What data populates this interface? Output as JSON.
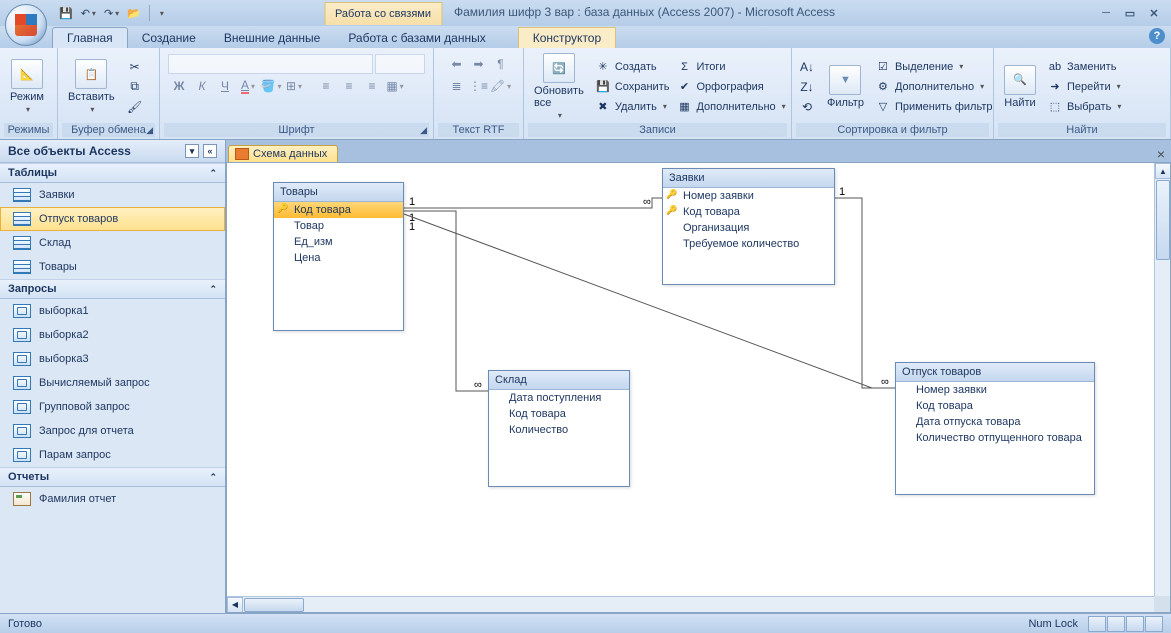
{
  "title": "Фамилия шифр 3 вар : база данных (Access 2007) - Microsoft Access",
  "contextual_title": "Работа со связями",
  "tabs": {
    "home": "Главная",
    "create": "Создание",
    "external": "Внешние данные",
    "dbtools": "Работа с базами данных",
    "designer": "Конструктор"
  },
  "ribbon": {
    "modes": {
      "view": "Режим",
      "label": "Режимы"
    },
    "clipboard": {
      "paste": "Вставить",
      "label": "Буфер обмена"
    },
    "font": {
      "label": "Шрифт"
    },
    "rtf": {
      "label": "Текст RTF"
    },
    "records": {
      "refresh": "Обновить\nвсе",
      "create": "Создать",
      "save": "Сохранить",
      "delete": "Удалить",
      "totals": "Итоги",
      "spelling": "Орфография",
      "more": "Дополнительно",
      "label": "Записи"
    },
    "sortfilter": {
      "filter": "Фильтр",
      "selection": "Выделение",
      "advanced": "Дополнительно",
      "toggle": "Применить фильтр",
      "label": "Сортировка и фильтр"
    },
    "find": {
      "find": "Найти",
      "replace": "Заменить",
      "goto": "Перейти",
      "select": "Выбрать",
      "label": "Найти"
    }
  },
  "nav": {
    "title": "Все объекты Access",
    "tables_label": "Таблицы",
    "tables": [
      "Заявки",
      "Отпуск товаров",
      "Склад",
      "Товары"
    ],
    "queries_label": "Запросы",
    "queries": [
      "выборка1",
      "выборка2",
      "выборка3",
      "Вычисляемый запрос",
      "Групповой запрос",
      "Запрос для отчета",
      "Парам запрос"
    ],
    "reports_label": "Отчеты",
    "reports": [
      "Фамилия отчет"
    ],
    "selected": "Отпуск товаров"
  },
  "doc_tab": "Схема данных",
  "diagram": {
    "t1": {
      "title": "Товары",
      "fields": [
        "Код товара",
        "Товар",
        "Ед_изм",
        "Цена"
      ],
      "pk": [
        0
      ],
      "sel": 0
    },
    "t2": {
      "title": "Заявки",
      "fields": [
        "Номер заявки",
        "Код товара",
        "Организация",
        "Требуемое количество"
      ],
      "pk": [
        0,
        1
      ]
    },
    "t3": {
      "title": "Склад",
      "fields": [
        "Дата поступления",
        "Код товара",
        "Количество"
      ]
    },
    "t4": {
      "title": "Отпуск товаров",
      "fields": [
        "Номер заявки",
        "Код товара",
        "Дата отпуска товара",
        "Количество отпущенного товара"
      ]
    },
    "rel": {
      "one": "1",
      "many": "∞"
    }
  },
  "status": {
    "ready": "Готово",
    "numlock": "Num Lock"
  }
}
